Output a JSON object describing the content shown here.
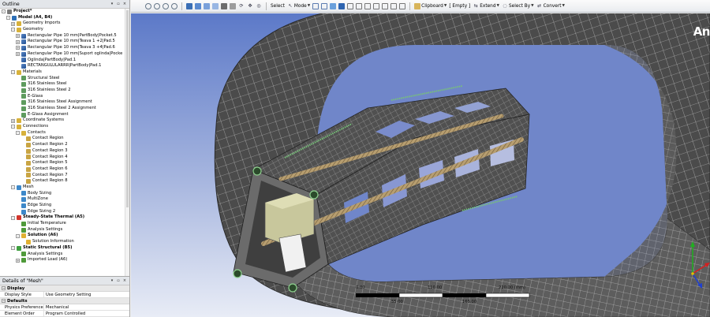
{
  "outline": {
    "title": "Outline",
    "controls": [
      "▾",
      "▫",
      "×"
    ],
    "tree": [
      {
        "label": "Project*",
        "level": 0,
        "bold": true,
        "icon": "project-icon",
        "exp": "-"
      },
      {
        "label": "Model (A4, B4)",
        "level": 1,
        "bold": true,
        "icon": "model-icon",
        "exp": "-"
      },
      {
        "label": "Geometry Imports",
        "level": 2,
        "bold": false,
        "icon": "folder-icon",
        "exp": "+"
      },
      {
        "label": "Geometry",
        "level": 2,
        "bold": false,
        "icon": "folder-icon",
        "exp": "-"
      },
      {
        "label": "Rectangular Pipe 10 mm|PartBody|Pocket.5",
        "level": 3,
        "bold": false,
        "icon": "body-icon",
        "exp": "+"
      },
      {
        "label": "Rectangular Pipe 10 mm|Teava 1 +2|Pad.5",
        "level": 3,
        "bold": false,
        "icon": "body-icon",
        "exp": "+"
      },
      {
        "label": "Rectangular Pipe 10 mm|Teava 3 +4|Pad.6",
        "level": 3,
        "bold": false,
        "icon": "body-icon",
        "exp": "+"
      },
      {
        "label": "Rectangular Pipe 10 mm|Suport oglinda|Pocke",
        "level": 3,
        "bold": false,
        "icon": "body-icon",
        "exp": "+"
      },
      {
        "label": "Oglinda|PartBody|Pad.1",
        "level": 3,
        "bold": false,
        "icon": "body-icon",
        "exp": ""
      },
      {
        "label": "RECTANGULULARRR|PartBody|Pad.1",
        "level": 3,
        "bold": false,
        "icon": "body-icon",
        "exp": ""
      },
      {
        "label": "Materials",
        "level": 2,
        "bold": false,
        "icon": "folder-icon",
        "exp": "-"
      },
      {
        "label": "Structural Steel",
        "level": 3,
        "bold": false,
        "icon": "material-icon",
        "exp": ""
      },
      {
        "label": "316 Stainless Steel",
        "level": 3,
        "bold": false,
        "icon": "material-icon",
        "exp": ""
      },
      {
        "label": "316 Stainless Steel 2",
        "level": 3,
        "bold": false,
        "icon": "material-icon",
        "exp": ""
      },
      {
        "label": "E-Glass",
        "level": 3,
        "bold": false,
        "icon": "material-icon",
        "exp": ""
      },
      {
        "label": "316 Stainless Steel Assignment",
        "level": 3,
        "bold": false,
        "icon": "material-icon",
        "exp": ""
      },
      {
        "label": "316 Stainless Steel 2 Assignment",
        "level": 3,
        "bold": false,
        "icon": "material-icon",
        "exp": ""
      },
      {
        "label": "E-Glass Assignment",
        "level": 3,
        "bold": false,
        "icon": "material-icon",
        "exp": ""
      },
      {
        "label": "Coordinate Systems",
        "level": 2,
        "bold": false,
        "icon": "folder-icon",
        "exp": "+"
      },
      {
        "label": "Connections",
        "level": 2,
        "bold": false,
        "icon": "folder-icon",
        "exp": "-"
      },
      {
        "label": "Contacts",
        "level": 3,
        "bold": false,
        "icon": "folder-icon",
        "exp": "-"
      },
      {
        "label": "Contact Region",
        "level": 4,
        "bold": false,
        "icon": "contact-icon",
        "exp": ""
      },
      {
        "label": "Contact Region 2",
        "level": 4,
        "bold": false,
        "icon": "contact-icon",
        "exp": ""
      },
      {
        "label": "Contact Region 3",
        "level": 4,
        "bold": false,
        "icon": "contact-icon",
        "exp": ""
      },
      {
        "label": "Contact Region 4",
        "level": 4,
        "bold": false,
        "icon": "contact-icon",
        "exp": ""
      },
      {
        "label": "Contact Region 5",
        "level": 4,
        "bold": false,
        "icon": "contact-icon",
        "exp": ""
      },
      {
        "label": "Contact Region 6",
        "level": 4,
        "bold": false,
        "icon": "contact-icon",
        "exp": ""
      },
      {
        "label": "Contact Region 7",
        "level": 4,
        "bold": false,
        "icon": "contact-icon",
        "exp": ""
      },
      {
        "label": "Contact Region 8",
        "level": 4,
        "bold": false,
        "icon": "contact-icon",
        "exp": ""
      },
      {
        "label": "Mesh",
        "level": 2,
        "bold": false,
        "icon": "mesh-icon",
        "exp": "-"
      },
      {
        "label": "Body Sizing",
        "level": 3,
        "bold": false,
        "icon": "mesh-icon",
        "exp": ""
      },
      {
        "label": "MultiZone",
        "level": 3,
        "bold": false,
        "icon": "mesh-icon",
        "exp": ""
      },
      {
        "label": "Edge Sizing",
        "level": 3,
        "bold": false,
        "icon": "mesh-icon",
        "exp": ""
      },
      {
        "label": "Edge Sizing 2",
        "level": 3,
        "bold": false,
        "icon": "mesh-icon",
        "exp": ""
      },
      {
        "label": "Steady-State Thermal (A5)",
        "level": 2,
        "bold": true,
        "icon": "thermal-icon",
        "exp": "-"
      },
      {
        "label": "Initial Temperature",
        "level": 3,
        "bold": false,
        "icon": "check-icon",
        "exp": ""
      },
      {
        "label": "Analysis Settings",
        "level": 3,
        "bold": false,
        "icon": "check-icon",
        "exp": ""
      },
      {
        "label": "Solution (A6)",
        "level": 3,
        "bold": true,
        "icon": "solution-icon",
        "exp": "-"
      },
      {
        "label": "Solution Information",
        "level": 4,
        "bold": false,
        "icon": "solution-icon",
        "exp": ""
      },
      {
        "label": "Static Structural (B5)",
        "level": 2,
        "bold": true,
        "icon": "structural-icon",
        "exp": "-"
      },
      {
        "label": "Analysis Settings",
        "level": 3,
        "bold": false,
        "icon": "check-icon",
        "exp": ""
      },
      {
        "label": "Imported Load (A6)",
        "level": 3,
        "bold": false,
        "icon": "check-icon",
        "exp": "+"
      }
    ]
  },
  "details": {
    "title": "Details of \"Mesh\"",
    "sections": [
      {
        "name": "Display",
        "rows": [
          {
            "key": "Display Style",
            "value": "Use Geometry Setting"
          }
        ]
      },
      {
        "name": "Defaults",
        "rows": [
          {
            "key": "Physics Preference",
            "value": "Mechanical"
          },
          {
            "key": "Element Order",
            "value": "Program Controlled"
          }
        ]
      }
    ]
  },
  "toolbar": {
    "select_label": "Select",
    "mode_label": "Mode",
    "clipboard_label": "Clipboard",
    "empty_label": "[ Empty ]",
    "extend_label": "Extend",
    "select_by_label": "Select By",
    "convert_label": "Convert"
  },
  "viewport": {
    "logo_text": "An",
    "scale_labels": [
      "0.00",
      "110.00",
      "220.00 (mm)",
      "55.00",
      "165.00"
    ],
    "colors": {
      "background_top": "#5c79c8",
      "mesh_surface": "#4a4a4a",
      "mesh_line": "#c9c9c9",
      "rod": "#b4a07a",
      "block": "#c9c8a0",
      "triad_x": "#d42020",
      "triad_y": "#20b020",
      "triad_z": "#2040d0"
    }
  }
}
